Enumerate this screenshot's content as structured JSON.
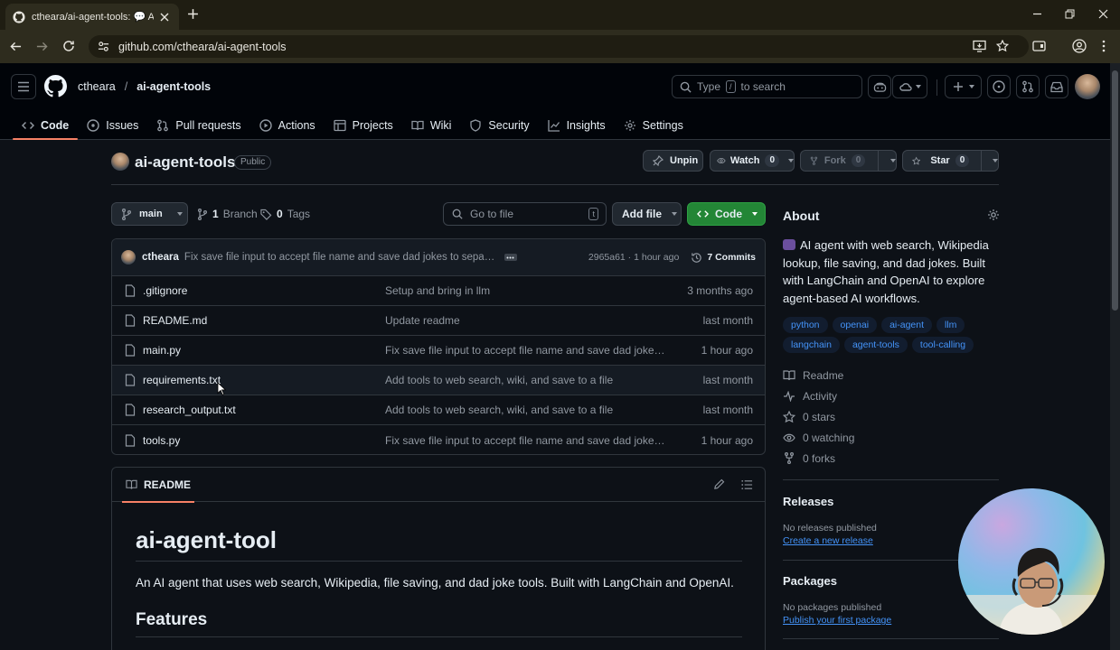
{
  "browser": {
    "tab_title": "ctheara/ai-agent-tools: 🗣 AI agent...",
    "tab_title_short": "ctheara/ai-agent-tools: 💬 AI a",
    "url": "github.com/ctheara/ai-agent-tools"
  },
  "header": {
    "owner": "ctheara",
    "separator": "/",
    "repo": "ai-agent-tools",
    "search_pre": "Type",
    "search_key": "/",
    "search_post": "to search"
  },
  "nav": {
    "tabs": [
      {
        "label": "Code",
        "icon": "code-icon"
      },
      {
        "label": "Issues",
        "icon": "issue-icon"
      },
      {
        "label": "Pull requests",
        "icon": "pull-request-icon"
      },
      {
        "label": "Actions",
        "icon": "play-icon"
      },
      {
        "label": "Projects",
        "icon": "table-icon"
      },
      {
        "label": "Wiki",
        "icon": "book-icon"
      },
      {
        "label": "Security",
        "icon": "shield-icon"
      },
      {
        "label": "Insights",
        "icon": "graph-icon"
      },
      {
        "label": "Settings",
        "icon": "gear-icon"
      }
    ]
  },
  "repo": {
    "name": "ai-agent-tools",
    "visibility": "Public",
    "unpin": "Unpin",
    "watch": "Watch",
    "watch_count": "0",
    "fork": "Fork",
    "fork_count": "0",
    "star": "Star",
    "star_count": "0"
  },
  "toolbar": {
    "branch": "main",
    "branch_count": "1",
    "branch_label": "Branch",
    "tag_count": "0",
    "tag_label": "Tags",
    "goto_placeholder": "Go to file",
    "goto_key": "t",
    "add_file": "Add file",
    "code": "Code"
  },
  "commit": {
    "author": "ctheara",
    "message": "Fix save file input to accept file name and save dad jokes to separat...",
    "hash_time": "2965a61 · 1 hour ago",
    "commits": "7 Commits"
  },
  "files": [
    {
      "name": ".gitignore",
      "message": "Setup and bring in llm",
      "date": "3 months ago"
    },
    {
      "name": "README.md",
      "message": "Update readme",
      "date": "last month"
    },
    {
      "name": "main.py",
      "message": "Fix save file input to accept file name and save dad jokes to ...",
      "date": "1 hour ago"
    },
    {
      "name": "requirements.txt",
      "message": "Add tools to web search, wiki, and save to a file",
      "date": "last month"
    },
    {
      "name": "research_output.txt",
      "message": "Add tools to web search, wiki, and save to a file",
      "date": "last month"
    },
    {
      "name": "tools.py",
      "message": "Fix save file input to accept file name and save dad jokes to ...",
      "date": "1 hour ago"
    }
  ],
  "readme": {
    "tab": "README",
    "title": "ai-agent-tool",
    "intro": "An AI agent that uses web search, Wikipedia, file saving, and dad joke tools. Built with LangChain and OpenAI.",
    "features": "Features"
  },
  "about": {
    "heading": "About",
    "description": "AI agent with web search, Wikipedia lookup, file saving, and dad jokes. Built with LangChain and OpenAI to explore agent-based AI workflows.",
    "topics_row1": [
      "python",
      "openai",
      "ai-agent",
      "llm"
    ],
    "topics_row2": [
      "langchain",
      "agent-tools",
      "tool-calling"
    ],
    "readme": "Readme",
    "activity": "Activity",
    "stars": "0 stars",
    "watching": "0 watching",
    "forks": "0 forks"
  },
  "releases": {
    "heading": "Releases",
    "none": "No releases published",
    "create": "Create a new release"
  },
  "packages": {
    "heading": "Packages",
    "none": "No packages published",
    "publish": "Publish your first package"
  },
  "colors": {
    "accent_green": "#238636",
    "link_blue": "#4493f8",
    "tab_underline": "#f78166"
  }
}
